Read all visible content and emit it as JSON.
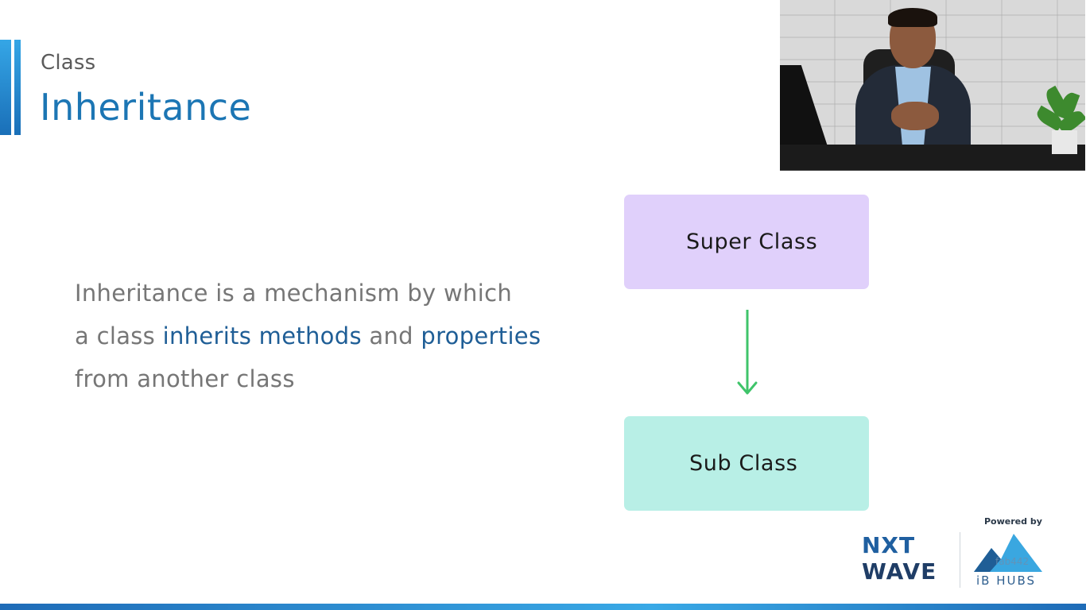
{
  "slide": {
    "kicker": "Class",
    "title": "Inheritance",
    "body": {
      "line1": "Inheritance is a mechanism by which",
      "line2_pre": "a class ",
      "line2_hl1": "inherits methods",
      "line2_mid": " and ",
      "line2_hl2": "properties",
      "line3": "from another class"
    }
  },
  "diagram": {
    "super_label": "Super Class",
    "sub_label": "Sub Class",
    "super_color": "#e0d0fb",
    "sub_color": "#b8efe6",
    "arrow_color": "#3fc46a"
  },
  "branding": {
    "powered_by": "Powered by",
    "brand_top": "NXT",
    "brand_bottom": "WAVE",
    "partner_name": "iB HUBS",
    "partner_watermark": "fab442"
  },
  "video": {
    "icon": "presenter-video-feed"
  },
  "colors": {
    "title": "#1c76b4",
    "highlight": "#1f5e96",
    "accent": "#2a8fd6"
  }
}
